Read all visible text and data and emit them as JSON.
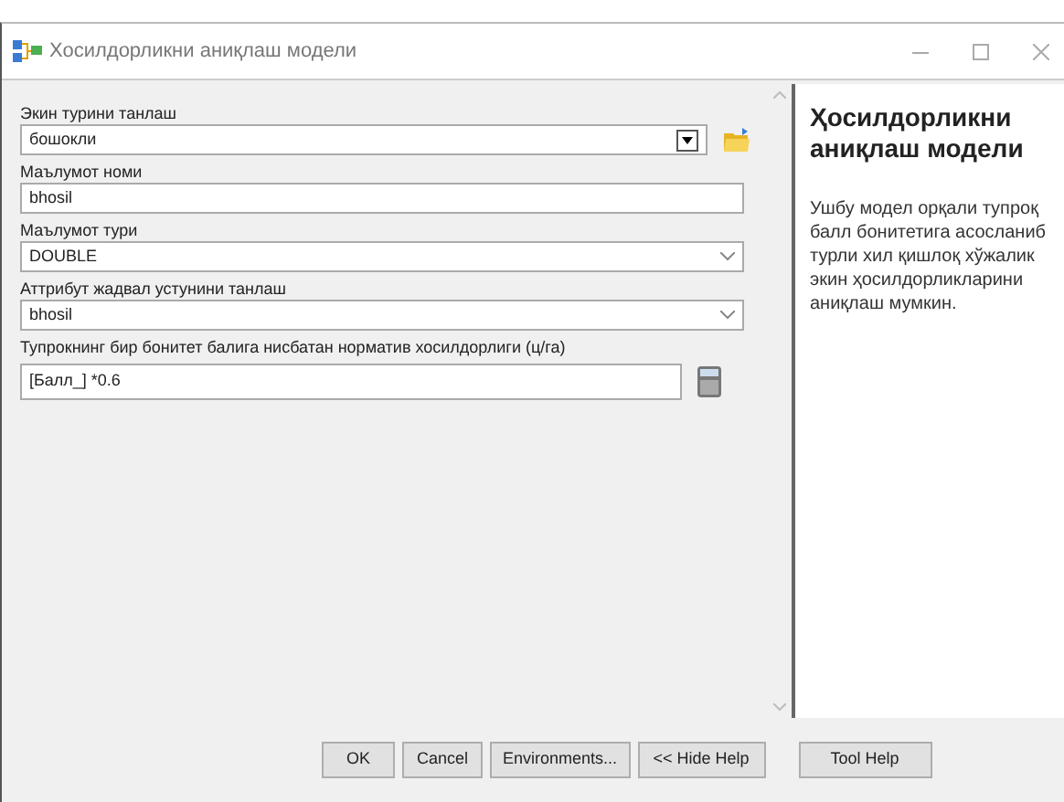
{
  "window": {
    "title": "Хосилдорликни аниқлаш модели"
  },
  "parameters": [
    {
      "kind": "combo",
      "label": "Экин турини танлаш",
      "value": "бошокли"
    },
    {
      "kind": "text",
      "label": "Маълумот номи",
      "value": "bhosil"
    },
    {
      "kind": "select",
      "label": "Маълумот тури",
      "value": "DOUBLE"
    },
    {
      "kind": "select",
      "label": "Аттрибут жадвал устунини танлаш",
      "value": "bhosil"
    },
    {
      "kind": "expression",
      "label": "Тупрокнинг бир бонитет балига нисбатан норматив хосилдорлиги (ц/га)",
      "value": "[Балл_] *0.6"
    }
  ],
  "help": {
    "title": "Ҳосилдорликни аниқлаш модели",
    "text": "Ушбу модел орқали тупроқ балл бонитетига асосланиб турли хил қишлоқ хўжалик экин ҳосилдорликларини аниқлаш мумкин."
  },
  "buttons": [
    "OK",
    "Cancel",
    "Environments...",
    "<< Hide Help",
    "Tool Help"
  ]
}
